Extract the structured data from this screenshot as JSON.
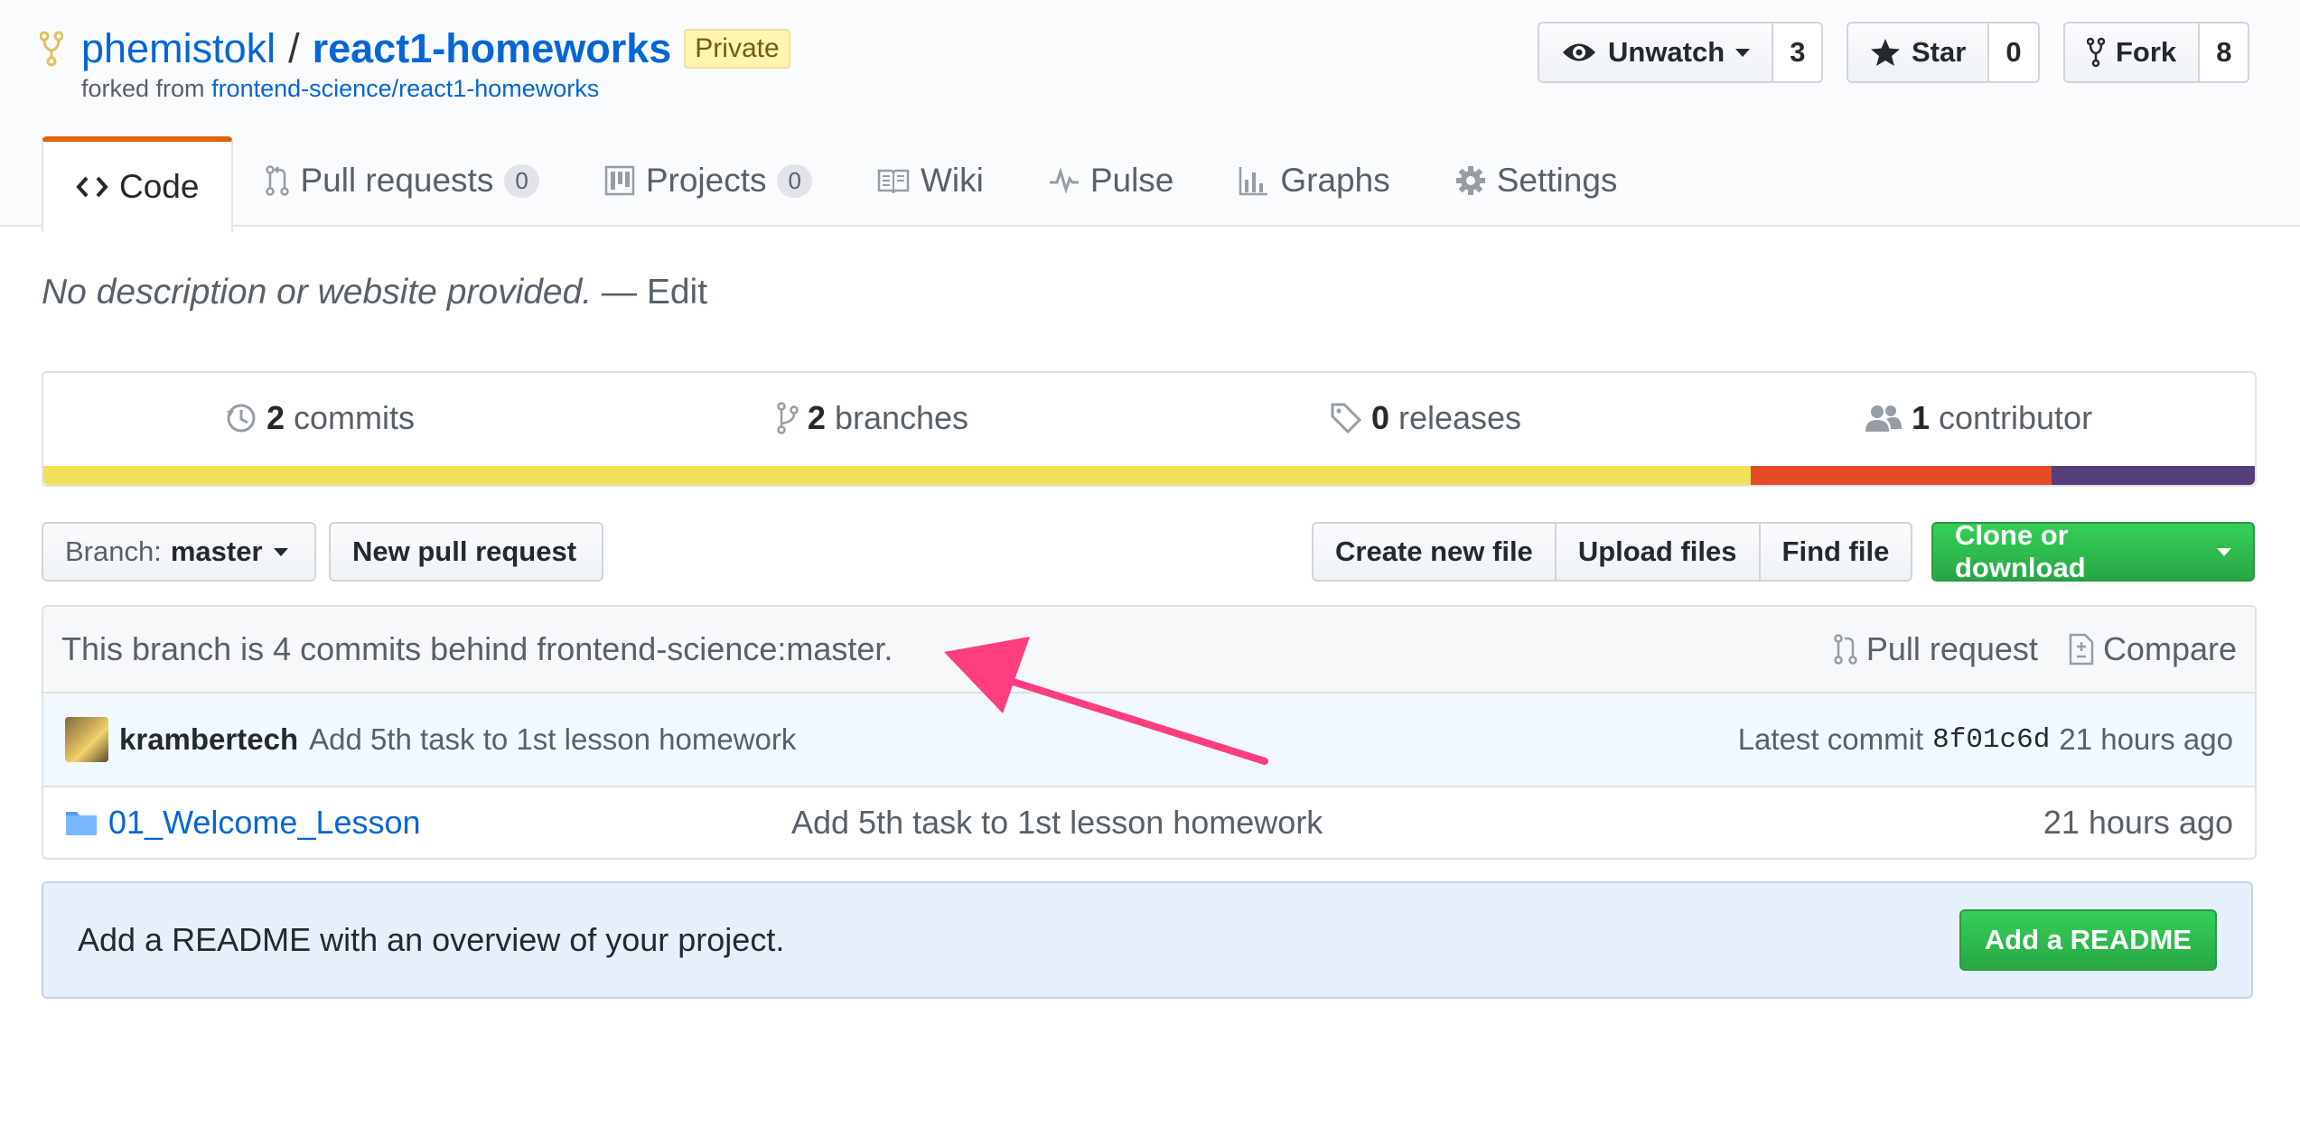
{
  "repo": {
    "owner": "phemistokl",
    "separator": "/",
    "name": "react1-homeworks",
    "visibility": "Private",
    "forked_prefix": "forked from",
    "forked_source": "frontend-science/react1-homeworks"
  },
  "header_actions": {
    "watch_label": "Unwatch",
    "watch_count": "3",
    "star_label": "Star",
    "star_count": "0",
    "fork_label": "Fork",
    "fork_count": "8"
  },
  "tabs": [
    {
      "label": "Code",
      "icon": "code-icon",
      "selected": true
    },
    {
      "label": "Pull requests",
      "counter": "0",
      "icon": "pull-request-icon"
    },
    {
      "label": "Projects",
      "counter": "0",
      "icon": "project-icon"
    },
    {
      "label": "Wiki",
      "icon": "book-icon"
    },
    {
      "label": "Pulse",
      "icon": "pulse-icon"
    },
    {
      "label": "Graphs",
      "icon": "graph-icon"
    },
    {
      "label": "Settings",
      "icon": "gear-icon"
    }
  ],
  "description": {
    "text": "No description or website provided.",
    "dash": "—",
    "edit_label": "Edit"
  },
  "summary": {
    "commits_count": "2",
    "commits_label": "commits",
    "branches_count": "2",
    "branches_label": "branches",
    "releases_count": "0",
    "releases_label": "releases",
    "contributors_count": "1",
    "contributors_label": "contributor",
    "language_colors": [
      "#f1e05a",
      "#e34c26",
      "#563d7c"
    ],
    "language_shares": [
      0.772,
      0.136,
      0.092
    ]
  },
  "file_nav": {
    "branch_prefix": "Branch:",
    "branch_name": "master",
    "new_pr_label": "New pull request",
    "create_file_label": "Create new file",
    "upload_label": "Upload files",
    "find_file_label": "Find file",
    "clone_label": "Clone or download"
  },
  "behind": {
    "text": "This branch is 4 commits behind frontend-science:master.",
    "pull_request_label": "Pull request",
    "compare_label": "Compare"
  },
  "latest_commit": {
    "author": "krambertech",
    "message": "Add 5th task to 1st lesson homework",
    "prefix": "Latest commit",
    "sha": "8f01c6d",
    "age": "21 hours ago"
  },
  "files": [
    {
      "name": "01_Welcome_Lesson",
      "message": "Add 5th task to 1st lesson homework",
      "age": "21 hours ago",
      "icon": "folder-icon"
    }
  ],
  "readme_notice": {
    "text": "Add a README with an overview of your project.",
    "button_label": "Add a README"
  },
  "colors": {
    "link": "#0366d6",
    "selected_tab_accent": "#e36209",
    "annotation_arrow": "#ff3d7f",
    "green_button": "#28a745"
  }
}
